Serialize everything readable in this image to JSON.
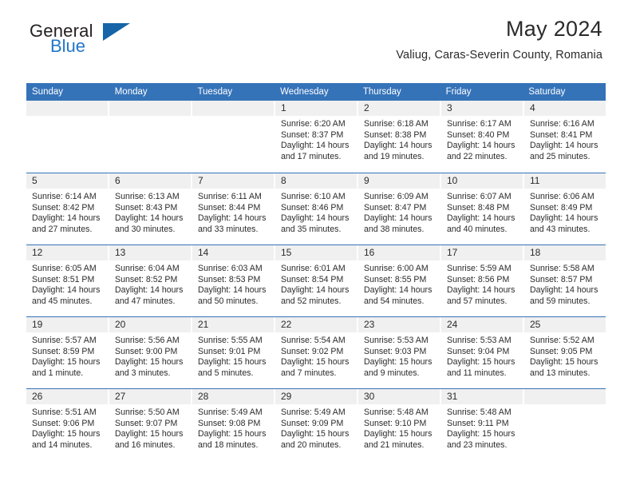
{
  "brand": {
    "name_top": "General",
    "name_bottom": "Blue",
    "triangle_color": "#1565a8",
    "blue_color": "#2277c8"
  },
  "header": {
    "title": "May 2024",
    "location": "Valiug, Caras-Severin County, Romania"
  },
  "theme": {
    "header_blue": "#3573b9",
    "daynum_bg": "#f0f0f0",
    "text": "#2b2b2b"
  },
  "weekdays": [
    "Sunday",
    "Monday",
    "Tuesday",
    "Wednesday",
    "Thursday",
    "Friday",
    "Saturday"
  ],
  "weeks": [
    [
      {
        "day": "",
        "sunrise": "",
        "sunset": "",
        "daylight1": "",
        "daylight2": ""
      },
      {
        "day": "",
        "sunrise": "",
        "sunset": "",
        "daylight1": "",
        "daylight2": ""
      },
      {
        "day": "",
        "sunrise": "",
        "sunset": "",
        "daylight1": "",
        "daylight2": ""
      },
      {
        "day": "1",
        "sunrise": "Sunrise: 6:20 AM",
        "sunset": "Sunset: 8:37 PM",
        "daylight1": "Daylight: 14 hours",
        "daylight2": "and 17 minutes."
      },
      {
        "day": "2",
        "sunrise": "Sunrise: 6:18 AM",
        "sunset": "Sunset: 8:38 PM",
        "daylight1": "Daylight: 14 hours",
        "daylight2": "and 19 minutes."
      },
      {
        "day": "3",
        "sunrise": "Sunrise: 6:17 AM",
        "sunset": "Sunset: 8:40 PM",
        "daylight1": "Daylight: 14 hours",
        "daylight2": "and 22 minutes."
      },
      {
        "day": "4",
        "sunrise": "Sunrise: 6:16 AM",
        "sunset": "Sunset: 8:41 PM",
        "daylight1": "Daylight: 14 hours",
        "daylight2": "and 25 minutes."
      }
    ],
    [
      {
        "day": "5",
        "sunrise": "Sunrise: 6:14 AM",
        "sunset": "Sunset: 8:42 PM",
        "daylight1": "Daylight: 14 hours",
        "daylight2": "and 27 minutes."
      },
      {
        "day": "6",
        "sunrise": "Sunrise: 6:13 AM",
        "sunset": "Sunset: 8:43 PM",
        "daylight1": "Daylight: 14 hours",
        "daylight2": "and 30 minutes."
      },
      {
        "day": "7",
        "sunrise": "Sunrise: 6:11 AM",
        "sunset": "Sunset: 8:44 PM",
        "daylight1": "Daylight: 14 hours",
        "daylight2": "and 33 minutes."
      },
      {
        "day": "8",
        "sunrise": "Sunrise: 6:10 AM",
        "sunset": "Sunset: 8:46 PM",
        "daylight1": "Daylight: 14 hours",
        "daylight2": "and 35 minutes."
      },
      {
        "day": "9",
        "sunrise": "Sunrise: 6:09 AM",
        "sunset": "Sunset: 8:47 PM",
        "daylight1": "Daylight: 14 hours",
        "daylight2": "and 38 minutes."
      },
      {
        "day": "10",
        "sunrise": "Sunrise: 6:07 AM",
        "sunset": "Sunset: 8:48 PM",
        "daylight1": "Daylight: 14 hours",
        "daylight2": "and 40 minutes."
      },
      {
        "day": "11",
        "sunrise": "Sunrise: 6:06 AM",
        "sunset": "Sunset: 8:49 PM",
        "daylight1": "Daylight: 14 hours",
        "daylight2": "and 43 minutes."
      }
    ],
    [
      {
        "day": "12",
        "sunrise": "Sunrise: 6:05 AM",
        "sunset": "Sunset: 8:51 PM",
        "daylight1": "Daylight: 14 hours",
        "daylight2": "and 45 minutes."
      },
      {
        "day": "13",
        "sunrise": "Sunrise: 6:04 AM",
        "sunset": "Sunset: 8:52 PM",
        "daylight1": "Daylight: 14 hours",
        "daylight2": "and 47 minutes."
      },
      {
        "day": "14",
        "sunrise": "Sunrise: 6:03 AM",
        "sunset": "Sunset: 8:53 PM",
        "daylight1": "Daylight: 14 hours",
        "daylight2": "and 50 minutes."
      },
      {
        "day": "15",
        "sunrise": "Sunrise: 6:01 AM",
        "sunset": "Sunset: 8:54 PM",
        "daylight1": "Daylight: 14 hours",
        "daylight2": "and 52 minutes."
      },
      {
        "day": "16",
        "sunrise": "Sunrise: 6:00 AM",
        "sunset": "Sunset: 8:55 PM",
        "daylight1": "Daylight: 14 hours",
        "daylight2": "and 54 minutes."
      },
      {
        "day": "17",
        "sunrise": "Sunrise: 5:59 AM",
        "sunset": "Sunset: 8:56 PM",
        "daylight1": "Daylight: 14 hours",
        "daylight2": "and 57 minutes."
      },
      {
        "day": "18",
        "sunrise": "Sunrise: 5:58 AM",
        "sunset": "Sunset: 8:57 PM",
        "daylight1": "Daylight: 14 hours",
        "daylight2": "and 59 minutes."
      }
    ],
    [
      {
        "day": "19",
        "sunrise": "Sunrise: 5:57 AM",
        "sunset": "Sunset: 8:59 PM",
        "daylight1": "Daylight: 15 hours",
        "daylight2": "and 1 minute."
      },
      {
        "day": "20",
        "sunrise": "Sunrise: 5:56 AM",
        "sunset": "Sunset: 9:00 PM",
        "daylight1": "Daylight: 15 hours",
        "daylight2": "and 3 minutes."
      },
      {
        "day": "21",
        "sunrise": "Sunrise: 5:55 AM",
        "sunset": "Sunset: 9:01 PM",
        "daylight1": "Daylight: 15 hours",
        "daylight2": "and 5 minutes."
      },
      {
        "day": "22",
        "sunrise": "Sunrise: 5:54 AM",
        "sunset": "Sunset: 9:02 PM",
        "daylight1": "Daylight: 15 hours",
        "daylight2": "and 7 minutes."
      },
      {
        "day": "23",
        "sunrise": "Sunrise: 5:53 AM",
        "sunset": "Sunset: 9:03 PM",
        "daylight1": "Daylight: 15 hours",
        "daylight2": "and 9 minutes."
      },
      {
        "day": "24",
        "sunrise": "Sunrise: 5:53 AM",
        "sunset": "Sunset: 9:04 PM",
        "daylight1": "Daylight: 15 hours",
        "daylight2": "and 11 minutes."
      },
      {
        "day": "25",
        "sunrise": "Sunrise: 5:52 AM",
        "sunset": "Sunset: 9:05 PM",
        "daylight1": "Daylight: 15 hours",
        "daylight2": "and 13 minutes."
      }
    ],
    [
      {
        "day": "26",
        "sunrise": "Sunrise: 5:51 AM",
        "sunset": "Sunset: 9:06 PM",
        "daylight1": "Daylight: 15 hours",
        "daylight2": "and 14 minutes."
      },
      {
        "day": "27",
        "sunrise": "Sunrise: 5:50 AM",
        "sunset": "Sunset: 9:07 PM",
        "daylight1": "Daylight: 15 hours",
        "daylight2": "and 16 minutes."
      },
      {
        "day": "28",
        "sunrise": "Sunrise: 5:49 AM",
        "sunset": "Sunset: 9:08 PM",
        "daylight1": "Daylight: 15 hours",
        "daylight2": "and 18 minutes."
      },
      {
        "day": "29",
        "sunrise": "Sunrise: 5:49 AM",
        "sunset": "Sunset: 9:09 PM",
        "daylight1": "Daylight: 15 hours",
        "daylight2": "and 20 minutes."
      },
      {
        "day": "30",
        "sunrise": "Sunrise: 5:48 AM",
        "sunset": "Sunset: 9:10 PM",
        "daylight1": "Daylight: 15 hours",
        "daylight2": "and 21 minutes."
      },
      {
        "day": "31",
        "sunrise": "Sunrise: 5:48 AM",
        "sunset": "Sunset: 9:11 PM",
        "daylight1": "Daylight: 15 hours",
        "daylight2": "and 23 minutes."
      },
      {
        "day": "",
        "sunrise": "",
        "sunset": "",
        "daylight1": "",
        "daylight2": ""
      }
    ]
  ]
}
